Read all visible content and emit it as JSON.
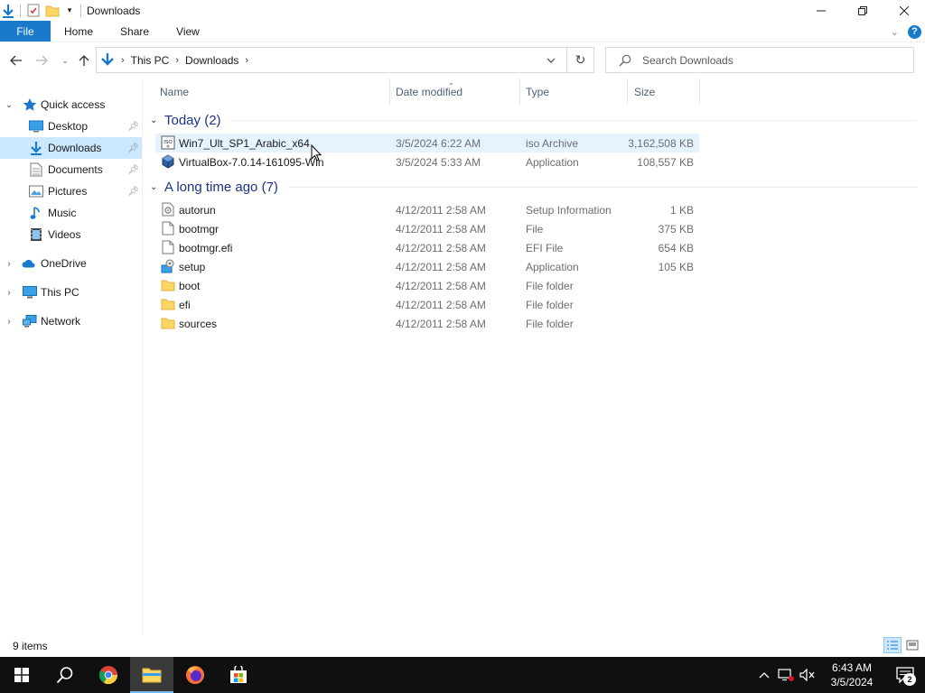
{
  "window": {
    "title": "Downloads",
    "controls": {
      "minimize": "—",
      "restore": "❐",
      "close": "✕"
    }
  },
  "ribbon": {
    "tabs": [
      "File",
      "Home",
      "Share",
      "View"
    ],
    "help": "?"
  },
  "address": {
    "crumbs": [
      "This PC",
      "Downloads"
    ]
  },
  "search": {
    "placeholder": "Search Downloads"
  },
  "sidebar": {
    "items": [
      {
        "label": "Quick access",
        "icon": "star-icon",
        "level": 0,
        "expanded": true
      },
      {
        "label": "Desktop",
        "icon": "desktop-icon",
        "level": 1,
        "pinned": true
      },
      {
        "label": "Downloads",
        "icon": "download-icon",
        "level": 1,
        "pinned": true,
        "selected": true
      },
      {
        "label": "Documents",
        "icon": "documents-icon",
        "level": 1,
        "pinned": true
      },
      {
        "label": "Pictures",
        "icon": "pictures-icon",
        "level": 1,
        "pinned": true
      },
      {
        "label": "Music",
        "icon": "music-icon",
        "level": 1
      },
      {
        "label": "Videos",
        "icon": "videos-icon",
        "level": 1
      },
      {
        "label": "OneDrive",
        "icon": "onedrive-icon",
        "level": 0,
        "expanded": false
      },
      {
        "label": "This PC",
        "icon": "this-pc-icon",
        "level": 0,
        "expanded": false
      },
      {
        "label": "Network",
        "icon": "network-icon",
        "level": 0,
        "expanded": false
      }
    ]
  },
  "columns": {
    "name": "Name",
    "date": "Date modified",
    "type": "Type",
    "size": "Size"
  },
  "groups": [
    {
      "title": "Today (2)",
      "files": [
        {
          "name": "Win7_Ult_SP1_Arabic_x64",
          "date": "3/5/2024 6:22 AM",
          "type": "iso Archive",
          "size": "3,162,508 KB",
          "icon": "iso-icon"
        },
        {
          "name": "VirtualBox-7.0.14-161095-Win",
          "date": "3/5/2024 5:33 AM",
          "type": "Application",
          "size": "108,557 KB",
          "icon": "virtualbox-icon"
        }
      ]
    },
    {
      "title": "A long time ago (7)",
      "files": [
        {
          "name": "autorun",
          "date": "4/12/2011 2:58 AM",
          "type": "Setup Information",
          "size": "1 KB",
          "icon": "setup-info-icon"
        },
        {
          "name": "bootmgr",
          "date": "4/12/2011 2:58 AM",
          "type": "File",
          "size": "375 KB",
          "icon": "file-icon"
        },
        {
          "name": "bootmgr.efi",
          "date": "4/12/2011 2:58 AM",
          "type": "EFI File",
          "size": "654 KB",
          "icon": "file-icon"
        },
        {
          "name": "setup",
          "date": "4/12/2011 2:58 AM",
          "type": "Application",
          "size": "105 KB",
          "icon": "setup-app-icon"
        },
        {
          "name": "boot",
          "date": "4/12/2011 2:58 AM",
          "type": "File folder",
          "size": "",
          "icon": "folder-icon"
        },
        {
          "name": "efi",
          "date": "4/12/2011 2:58 AM",
          "type": "File folder",
          "size": "",
          "icon": "folder-icon"
        },
        {
          "name": "sources",
          "date": "4/12/2011 2:58 AM",
          "type": "File folder",
          "size": "",
          "icon": "folder-icon"
        }
      ]
    }
  ],
  "status": {
    "item_count": "9 items"
  },
  "taskbar": {
    "apps": [
      "start",
      "search",
      "chrome",
      "file-explorer",
      "firefox",
      "store"
    ],
    "time": "6:43 AM",
    "date": "3/5/2024",
    "notification_count": "2"
  },
  "colors": {
    "accent": "#1979ca",
    "selection": "#cce8ff",
    "hover": "#e5f3ff",
    "group_header": "#1e3287",
    "taskbar": "#101010"
  }
}
